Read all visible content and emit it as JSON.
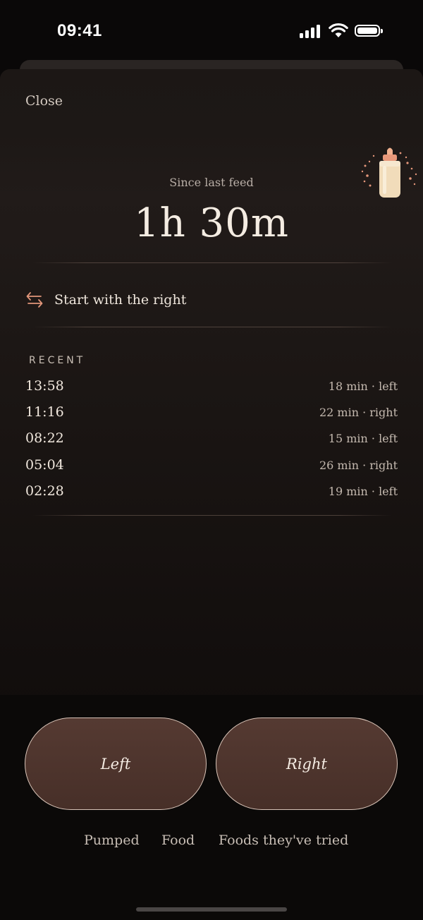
{
  "status_bar": {
    "time": "09:41"
  },
  "header": {
    "close_label": "Close"
  },
  "timer": {
    "caption": "Since last feed",
    "value": "1h 30m"
  },
  "suggestion": {
    "icon": "swap-arrows-icon",
    "text": "Start with the right"
  },
  "recent": {
    "label": "RECENT",
    "items": [
      {
        "time": "13:58",
        "detail": "18 min · left"
      },
      {
        "time": "11:16",
        "detail": "22 min · right"
      },
      {
        "time": "08:22",
        "detail": "15 min · left"
      },
      {
        "time": "05:04",
        "detail": "26 min · right"
      },
      {
        "time": "02:28",
        "detail": "19 min · left"
      }
    ]
  },
  "actions": {
    "left_label": "Left",
    "right_label": "Right"
  },
  "links": {
    "pumped": "Pumped",
    "food": "Food",
    "foods_tried": "Foods they've tried"
  },
  "colors": {
    "accent": "#e3967a",
    "button_fill": "#4f362f",
    "button_border": "#d8c3b7"
  }
}
